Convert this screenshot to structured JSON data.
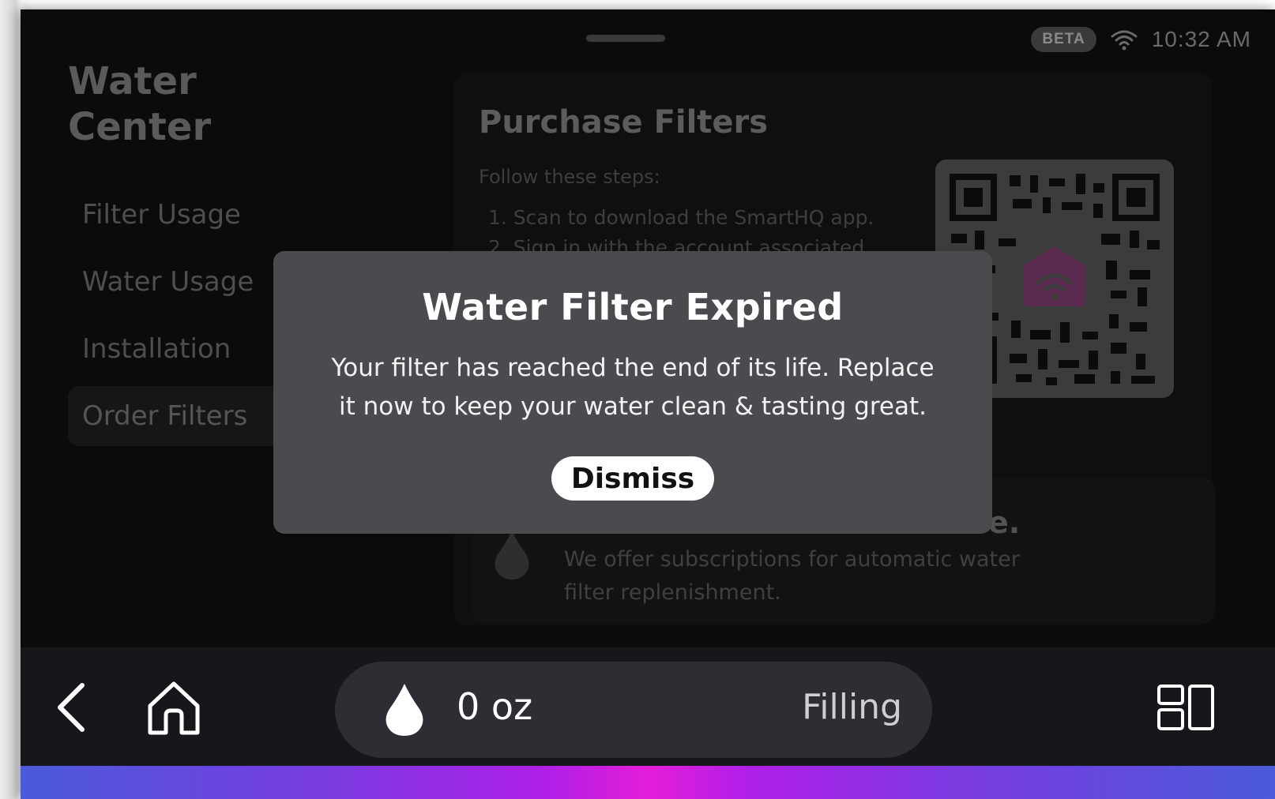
{
  "status_bar": {
    "beta_label": "BETA",
    "time": "10:32 AM",
    "wifi_icon": "wifi-icon"
  },
  "sidebar": {
    "title_line1": "Water",
    "title_line2": "Center",
    "items": [
      {
        "label": "Filter Usage"
      },
      {
        "label": "Water Usage"
      },
      {
        "label": "Installation"
      },
      {
        "label": "Order Filters",
        "active": true
      }
    ]
  },
  "main": {
    "card_title": "Purchase Filters",
    "steps_lead": "Follow these steps:",
    "steps": [
      "1. Scan to download the SmartHQ app.",
      "2. Sign in with the account associated"
    ],
    "qr_icon": "smarthq-logo-icon",
    "subscription_tail": "e.",
    "subscription_text": "We offer subscriptions for automatic water filter replenishment."
  },
  "modal": {
    "title": "Water Filter Expired",
    "line1": "Your filter has reached the end of its life. Replace",
    "line2": "it now to keep your water clean & tasting great.",
    "dismiss_label": "Dismiss"
  },
  "bottom_bar": {
    "amount": "0 oz",
    "status": "Filling"
  },
  "colors": {
    "screen_bg": "#0b0b0b",
    "modal_bg": "#4a4b4f",
    "bottom_bar_bg": "#16171b",
    "pill_bg": "#2c2e33",
    "accent_magenta": "#e41ed8",
    "accent_blue": "#4a5ad8"
  }
}
